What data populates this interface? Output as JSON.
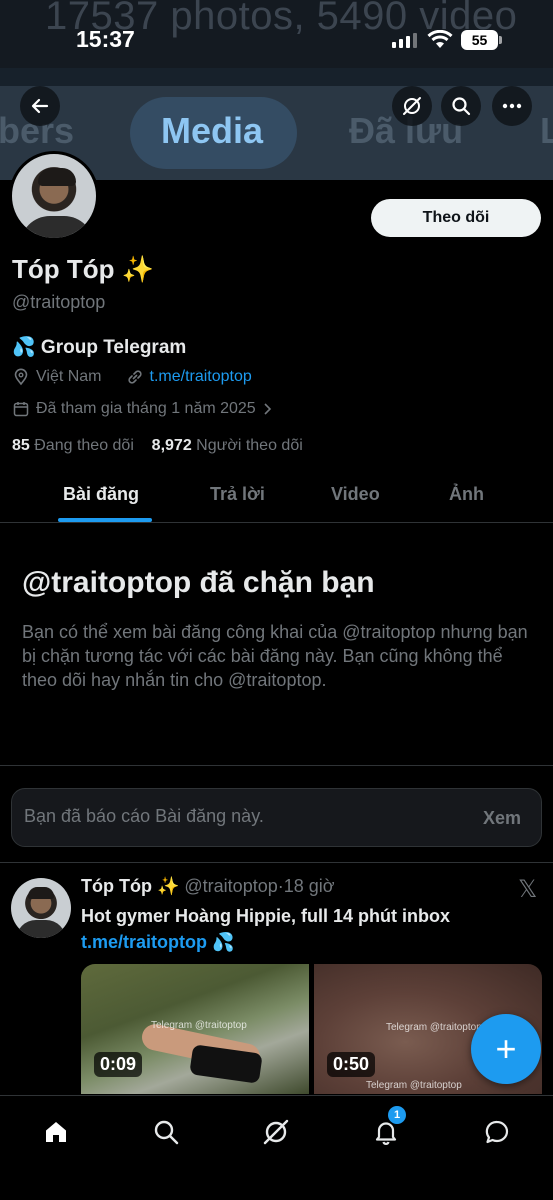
{
  "status_bar": {
    "time": "15:37",
    "battery": "55"
  },
  "banner": {
    "ghost_text": "17537 photos, 5490 video",
    "tabs": [
      {
        "label": "bers"
      },
      {
        "label": "Media"
      },
      {
        "label": "Đã lưu"
      }
    ]
  },
  "profile": {
    "follow_label": "Theo dõi",
    "display_name": "Tóp Tóp ✨",
    "handle": "@traitoptop",
    "bio": "💦 Group Telegram",
    "location": "Việt Nam",
    "link": "t.me/traitoptop",
    "joined": "Đã tham gia tháng 1 năm 2025",
    "following_count": "85",
    "following_label": "Đang theo dõi",
    "followers_count": "8,972",
    "followers_label": "Người theo dõi"
  },
  "tabs": [
    {
      "label": "Bài đăng"
    },
    {
      "label": "Trả lời"
    },
    {
      "label": "Video"
    },
    {
      "label": "Ảnh"
    }
  ],
  "blocked": {
    "title": "@traitoptop đã chặn bạn",
    "description": "Bạn có thể xem bài đăng công khai của @traitoptop nhưng bạn bị chặn tương tác với các bài đăng này. Bạn cũng không thể theo dõi hay nhắn tin cho @traitoptop."
  },
  "reported": {
    "text": "Bạn đã báo cáo Bài đăng này.",
    "view_label": "Xem"
  },
  "tweet": {
    "name": "Tóp Tóp ✨",
    "handle": "@traitoptop",
    "separator": "·",
    "time": "18 giờ",
    "text": "Hot gymer Hoàng Hippie, full 14 phút inbox",
    "link": "t.me/traitoptop",
    "link_emoji": "💦",
    "media": [
      {
        "duration": "0:09",
        "watermark": "Telegram @traitoptop"
      },
      {
        "duration": "0:50",
        "watermark": "Telegram @traitoptop",
        "watermark2": "Telegram @traitoptop"
      }
    ]
  },
  "compose": {
    "label": "+"
  },
  "bottom_nav": {
    "notification_count": "1"
  },
  "colors": {
    "accent": "#1d9bf0",
    "background": "#000000",
    "muted": "#71767b"
  }
}
